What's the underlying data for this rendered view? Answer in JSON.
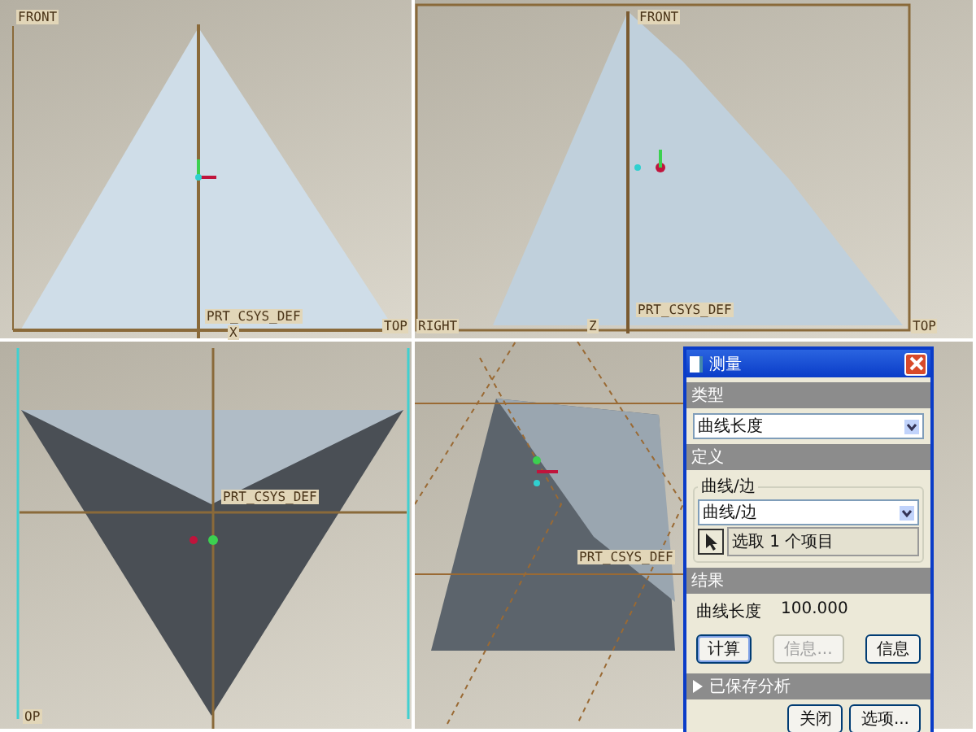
{
  "viewports": [
    {
      "kind": "front",
      "labels": [
        "FRONT",
        "PRT_CSYS_DEF",
        "TOP",
        "X"
      ]
    },
    {
      "kind": "side",
      "labels": [
        "FRONT",
        "RIGHT",
        "Z",
        "PRT_CSYS_DEF",
        "TOP"
      ]
    },
    {
      "kind": "bottom",
      "labels": [
        "PRT_CSYS_DEF",
        "OP"
      ]
    },
    {
      "kind": "iso",
      "labels": [
        "PRT_CSYS_DEF"
      ]
    }
  ],
  "dialog": {
    "title": "测量",
    "type_label": "类型",
    "type_value": "曲线长度",
    "define_label": "定义",
    "group_label": "曲线/边",
    "group_value": "曲线/边",
    "pick_text": "选取 1 个项目",
    "result_label": "结果",
    "result_name": "曲线长度",
    "result_value": "100.000",
    "action_buttons": [
      {
        "label": "计算",
        "disabled": false
      },
      {
        "label": "信息...",
        "disabled": true
      },
      {
        "label": "信息",
        "disabled": false
      }
    ],
    "saved_analysis": {
      "label": "已保存分析",
      "expanded": false
    },
    "footer_buttons": [
      "关闭",
      "选项..."
    ]
  }
}
